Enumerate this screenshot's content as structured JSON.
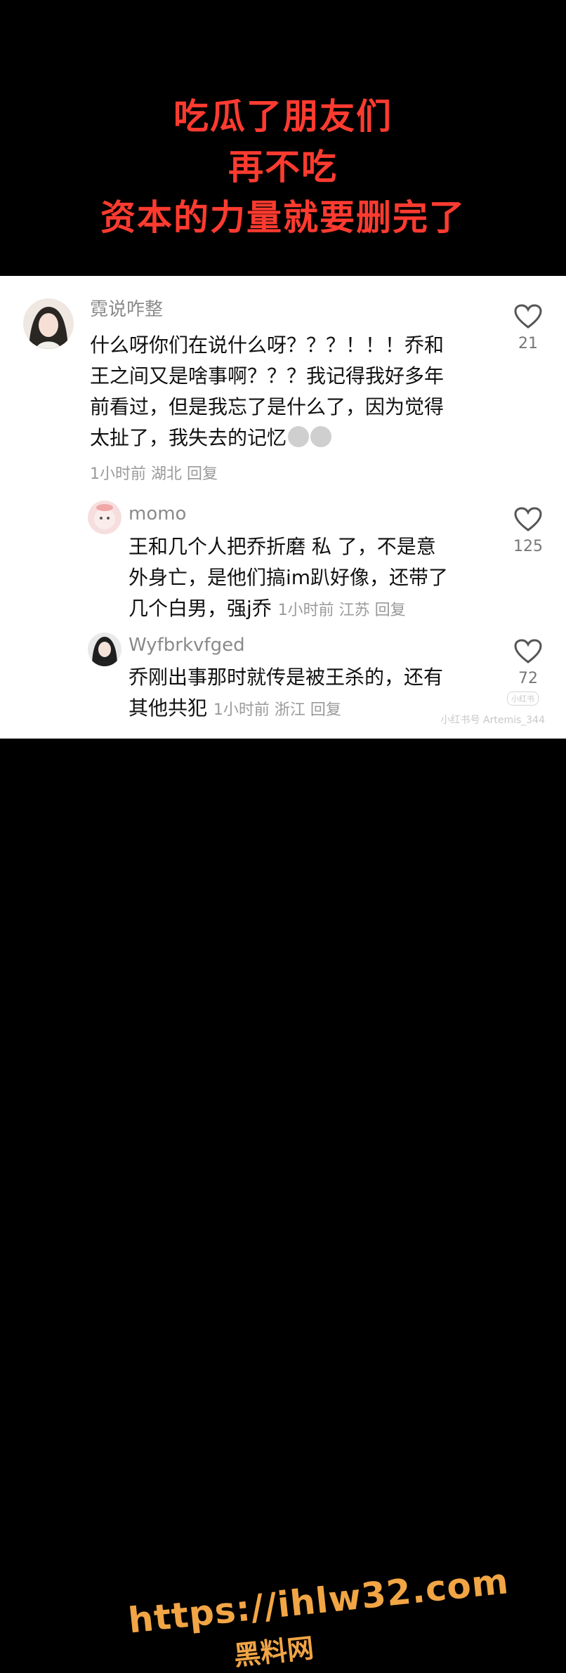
{
  "headline": {
    "lines": [
      "吃瓜了朋友们",
      "再不吃",
      "资本的力量就要删完了"
    ]
  },
  "comments": [
    {
      "username": "霓说咋整",
      "text_lines": [
        "什么呀你们在说什么呀？？？！！！乔和",
        "王之间又是啥事啊？？？我记得我好多年",
        "前看过，但是我忘了是什么了，因为觉得",
        "太扯了，我失去的记忆"
      ],
      "meta": "1小时前  湖北  回复",
      "likes": "21"
    },
    {
      "username": "momo",
      "text_lines": [
        "王和几个人把乔折磨 私 了，不是意",
        "外身亡，是他们搞im趴好像，还带了",
        "几个白男，强j乔"
      ],
      "meta": "1小时前  江苏  回复",
      "likes": "125"
    },
    {
      "username": "Wyfbrkvfged",
      "text_lines": [
        "乔刚出事那时就传是被王杀的，还有",
        "其他共犯"
      ],
      "meta": "1小时前  浙江  回复",
      "likes": "72"
    }
  ],
  "watermark": {
    "text": "小红书号  Artemis_344",
    "tag": "小红书"
  },
  "footer": {
    "url": "https://ihlw32.com",
    "subtitle": "黑料网"
  },
  "colors": {
    "headline": "#ff3b30",
    "footer": "#f1a545",
    "username": "#8a8a8a",
    "meta": "#9a9a9a"
  },
  "icons": {
    "like": "heart-outline-icon"
  }
}
